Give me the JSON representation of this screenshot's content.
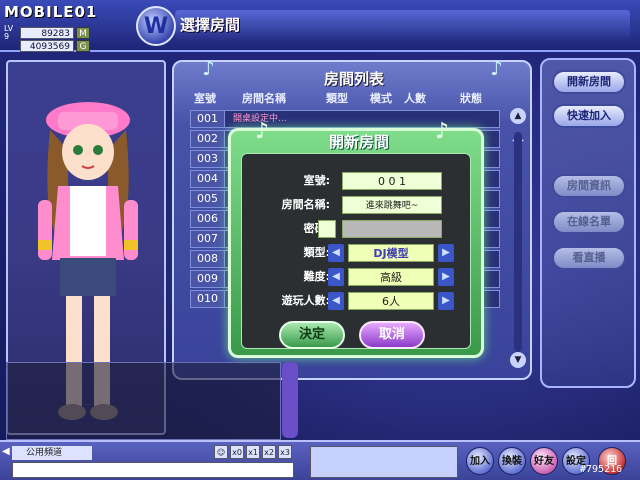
{
  "header": {
    "site_logo": "MOBILE01",
    "level_label": "LV 9",
    "money": "89283",
    "money_unit": "M",
    "gold": "4093569",
    "gold_unit": "G",
    "game_logo": "W",
    "screen_title": "選擇房間"
  },
  "room_list": {
    "title": "房間列表",
    "columns": [
      "室號",
      "房間名稱",
      "類型",
      "模式",
      "人數",
      "狀態"
    ],
    "rows": [
      {
        "num": "001",
        "name": "開桌設定中..."
      },
      {
        "num": "002",
        "name": ""
      },
      {
        "num": "003",
        "name": ""
      },
      {
        "num": "004",
        "name": ""
      },
      {
        "num": "005",
        "name": ""
      },
      {
        "num": "006",
        "name": ""
      },
      {
        "num": "007",
        "name": ""
      },
      {
        "num": "008",
        "name": ""
      },
      {
        "num": "009",
        "name": ""
      },
      {
        "num": "010",
        "name": ""
      }
    ]
  },
  "side_buttons": {
    "open_room": "開新房間",
    "quick_join": "快速加入",
    "room_info": "房間資訊",
    "online_list": "在線名單",
    "watch": "看直播"
  },
  "dialog": {
    "title": "開新房間",
    "room_no_label": "室號:",
    "room_no": "0 0 1",
    "room_name_label": "房間名稱:",
    "room_name": "進來跳舞吧~",
    "password_label": "密碼:",
    "type_label": "類型:",
    "type_value": "DJ模型",
    "difficulty_label": "難度:",
    "difficulty_value": "高級",
    "players_label": "遊玩人數:",
    "players_value": "6人",
    "confirm": "決定",
    "cancel": "取消"
  },
  "chat": {
    "channel": "公用頻道",
    "zoom": [
      "x0",
      "x1",
      "x2",
      "x3"
    ]
  },
  "bottom_buttons": {
    "join": "加入",
    "dress": "換裝",
    "friend": "好友",
    "settings": "設定",
    "back": "回"
  },
  "watermark": "#795216"
}
